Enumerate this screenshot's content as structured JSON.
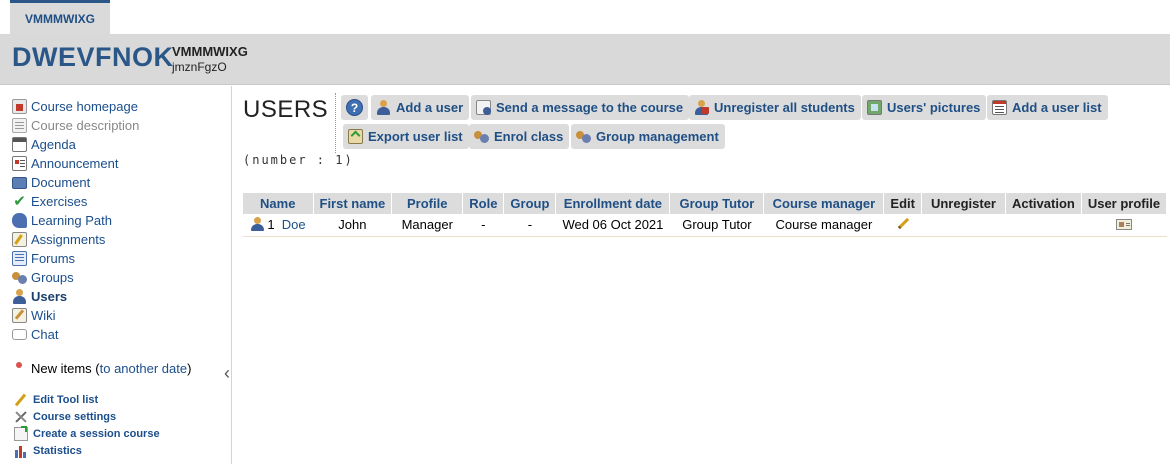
{
  "tab": {
    "label": "VMMMWIXG"
  },
  "course": {
    "title": "DWEVFNOK",
    "code": "VMMMWIXG",
    "subtitle": "jmznFgzO"
  },
  "sidebar": {
    "items": [
      {
        "label": "Course homepage",
        "icon": "house-icon",
        "state": "normal"
      },
      {
        "label": "Course description",
        "icon": "description-icon",
        "state": "disabled"
      },
      {
        "label": "Agenda",
        "icon": "calendar-icon",
        "state": "normal"
      },
      {
        "label": "Announcement",
        "icon": "announcement-icon",
        "state": "normal"
      },
      {
        "label": "Document",
        "icon": "folder-icon",
        "state": "normal"
      },
      {
        "label": "Exercises",
        "icon": "checkmark-icon",
        "state": "normal"
      },
      {
        "label": "Learning Path",
        "icon": "learning-path-icon",
        "state": "normal"
      },
      {
        "label": "Assignments",
        "icon": "assignment-icon",
        "state": "normal"
      },
      {
        "label": "Forums",
        "icon": "forum-icon",
        "state": "normal"
      },
      {
        "label": "Groups",
        "icon": "group-icon",
        "state": "normal"
      },
      {
        "label": "Users",
        "icon": "user-icon",
        "state": "active"
      },
      {
        "label": "Wiki",
        "icon": "wiki-icon",
        "state": "normal"
      },
      {
        "label": "Chat",
        "icon": "chat-icon",
        "state": "normal"
      }
    ],
    "new_items": {
      "label": "New items (",
      "link": "to another date",
      "suffix": ")"
    },
    "admin": [
      {
        "label": "Edit Tool list",
        "icon": "pencil-icon"
      },
      {
        "label": "Course settings",
        "icon": "tools-icon"
      },
      {
        "label": "Create a session course",
        "icon": "session-icon"
      },
      {
        "label": "Statistics",
        "icon": "statistics-icon"
      }
    ]
  },
  "page": {
    "title": "USERS",
    "count_label": "(number : 1)"
  },
  "toolbar": {
    "help_label": "?",
    "buttons": [
      {
        "label": "Add a user",
        "icon": "add-user-icon"
      },
      {
        "label": "Send a message to the course",
        "icon": "message-icon"
      },
      {
        "label": "Unregister all students",
        "icon": "unregister-icon"
      },
      {
        "label": "Users' pictures",
        "icon": "picture-icon"
      },
      {
        "label": "Add a user list",
        "icon": "user-list-icon"
      },
      {
        "label": "Export user list",
        "icon": "export-icon"
      },
      {
        "label": "Enrol class",
        "icon": "enrol-class-icon"
      },
      {
        "label": "Group management",
        "icon": "group-management-icon"
      }
    ]
  },
  "table": {
    "headers": [
      "Name",
      "First name",
      "Profile",
      "Role",
      "Group",
      "Enrollment date",
      "Group Tutor",
      "Course manager",
      "Edit",
      "Unregister",
      "Activation",
      "User profile"
    ],
    "rows": [
      {
        "index": "1",
        "name": "Doe",
        "first_name": "John",
        "profile": "Manager",
        "role": "-",
        "group": "-",
        "enrollment_date": "Wed 06 Oct 2021",
        "group_tutor": "Group Tutor",
        "course_manager": "Course manager"
      }
    ]
  },
  "colors": {
    "accent": "#1f4f85",
    "header_band": "#d9d9d9",
    "button_bg": "#dcdcdc"
  }
}
